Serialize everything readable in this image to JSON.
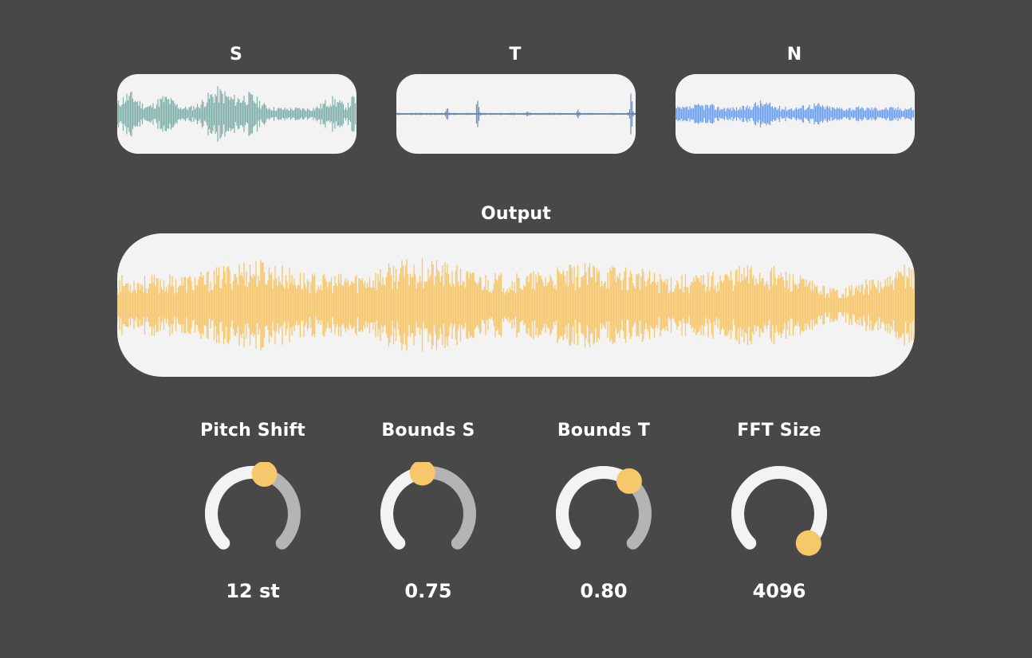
{
  "tracks": [
    {
      "label": "S",
      "color": "#7fb0aa"
    },
    {
      "label": "T",
      "color": "#6c8fb5"
    },
    {
      "label": "N",
      "color": "#6a9ff0"
    }
  ],
  "output": {
    "label": "Output",
    "color": "#f6c76b"
  },
  "knobs": [
    {
      "label": "Pitch Shift",
      "value": "12 st",
      "fraction": 0.56
    },
    {
      "label": "Bounds S",
      "value": "0.75",
      "fraction": 0.47
    },
    {
      "label": "Bounds T",
      "value": "0.80",
      "fraction": 0.64
    },
    {
      "label": "FFT Size",
      "value": "4096",
      "fraction": 1.0
    }
  ],
  "colors": {
    "background": "#484848",
    "panel": "#f3f3f3",
    "knob_track": "#f3f3f3",
    "knob_inactive": "#b4b4b4",
    "knob_handle": "#f6c76b"
  }
}
